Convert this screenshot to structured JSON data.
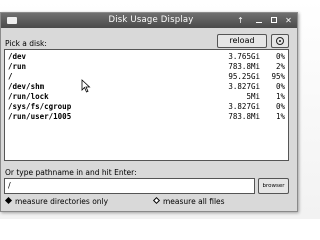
{
  "window": {
    "title": "Disk Usage Display",
    "buttons": {
      "up": "↑",
      "close": "✕"
    }
  },
  "toolbar": {
    "pick_label": "Pick a disk:",
    "reload_label": "reload",
    "toggle_icon": "target-ring-icon"
  },
  "disks": [
    {
      "path": "/dev",
      "size": "3.765Gi",
      "pct": "0%"
    },
    {
      "path": "/run",
      "size": "783.8Mi",
      "pct": "2%"
    },
    {
      "path": "/",
      "size": "95.25Gi",
      "pct": "95%"
    },
    {
      "path": "/dev/shm",
      "size": "3.827Gi",
      "pct": "0%"
    },
    {
      "path": "/run/lock",
      "size": "5Mi",
      "pct": "1%"
    },
    {
      "path": "/sys/fs/cgroup",
      "size": "3.827Gi",
      "pct": "0%"
    },
    {
      "path": "/run/user/1005",
      "size": "783.8Mi",
      "pct": "1%"
    }
  ],
  "pathname": {
    "label": "Or type pathname in and hit Enter:",
    "value": "/",
    "browse_label": "browser"
  },
  "mode": {
    "option_dirs_only": "measure directories only",
    "option_all_files": "measure all files",
    "selected": "measure directories only"
  }
}
